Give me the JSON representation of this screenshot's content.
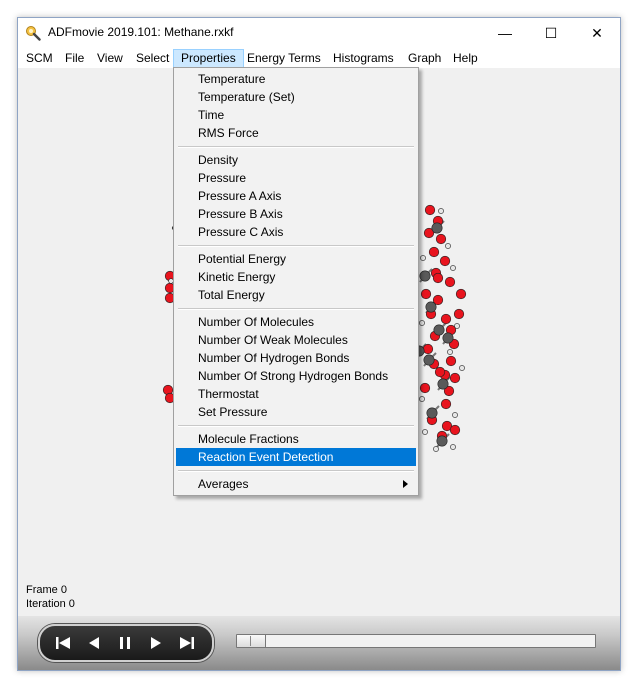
{
  "window": {
    "title": "ADFmovie 2019.101: Methane.rxkf",
    "minimize_glyph": "—",
    "maximize_glyph": "☐",
    "close_glyph": "✕"
  },
  "menubar": {
    "items": [
      "SCM",
      "File",
      "View",
      "Select",
      "Properties",
      "Energy Terms",
      "Histograms",
      "Graph",
      "Help"
    ],
    "active": "Properties"
  },
  "properties_menu": {
    "groups": [
      [
        "Temperature",
        "Temperature (Set)",
        "Time",
        "RMS Force"
      ],
      [
        "Density",
        "Pressure",
        "Pressure A Axis",
        "Pressure B Axis",
        "Pressure C Axis"
      ],
      [
        "Potential Energy",
        "Kinetic Energy",
        "Total Energy"
      ],
      [
        "Number Of Molecules",
        "Number Of Weak Molecules",
        "Number Of Hydrogen Bonds",
        "Number Of Strong Hydrogen Bonds",
        "Thermostat",
        "Set Pressure"
      ],
      [
        "Molecule Fractions",
        "Reaction Event Detection"
      ],
      [
        "Averages"
      ]
    ],
    "highlighted": "Reaction Event Detection",
    "submenu_item": "Averages"
  },
  "status": {
    "frame": "Frame 0",
    "iteration": "Iteration 0"
  },
  "player": {
    "slider_position": 0
  },
  "colors": {
    "oxygen": "#e8141e",
    "carbon": "#5a5a5a",
    "hydrogen": "#e6e6e6",
    "highlight": "#0078d7",
    "menu_active": "#cce8ff"
  }
}
